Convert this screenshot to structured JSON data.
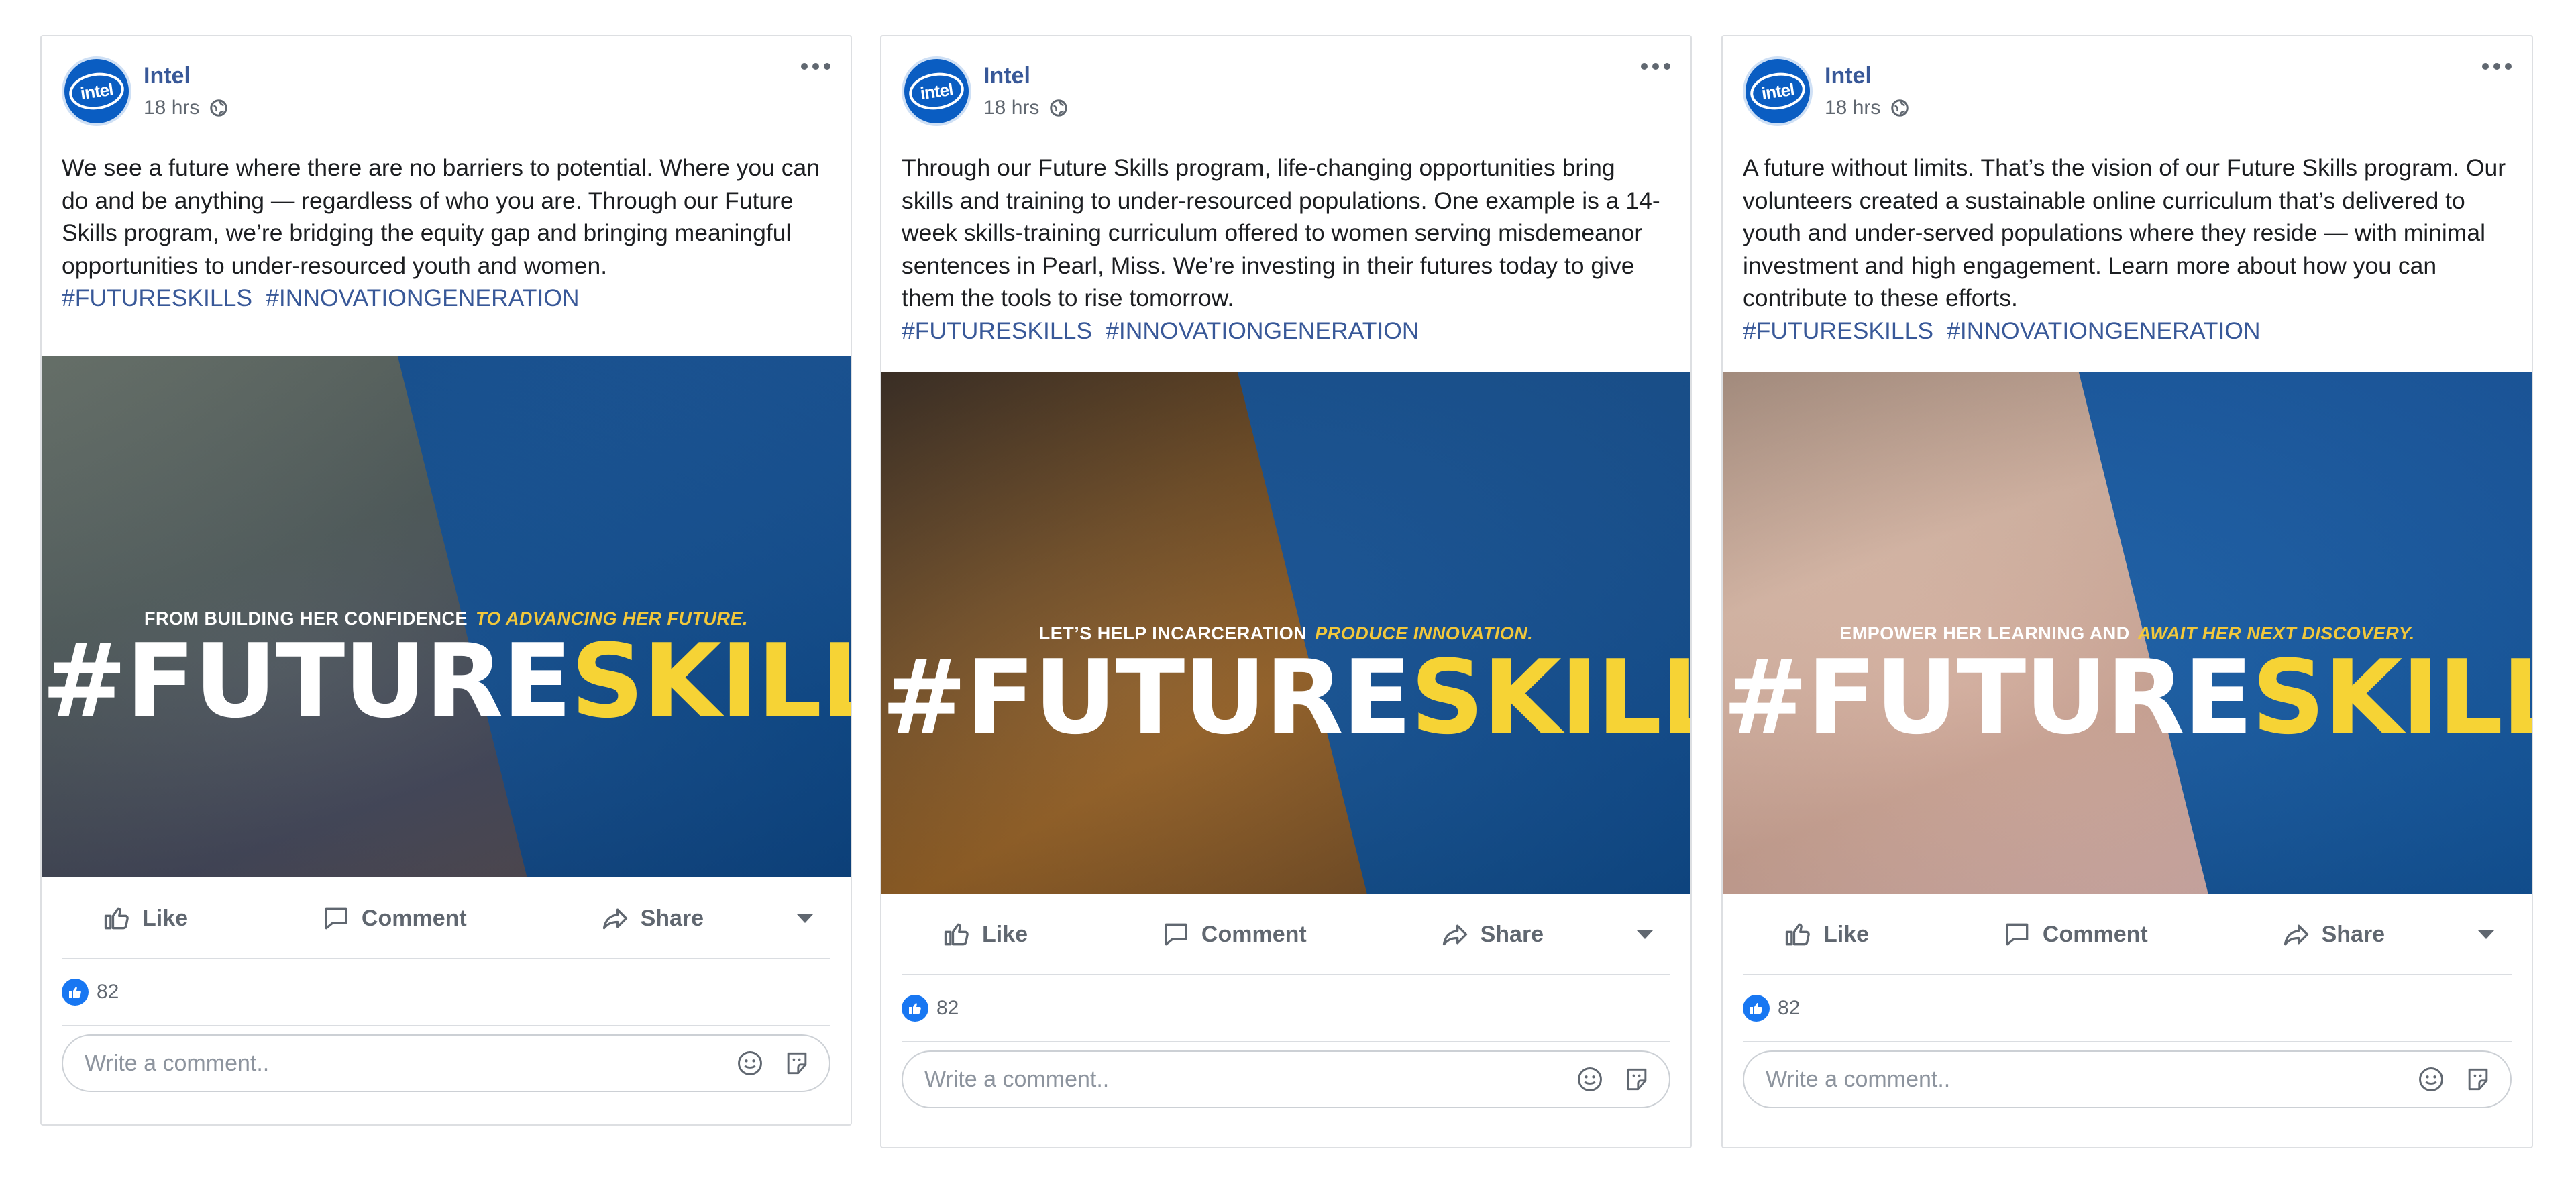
{
  "posts": [
    {
      "author": "Intel",
      "time": "18 hrs",
      "text": "We see a future where there are no barriers to potential. Where you can do and be anything — regardless of who you are. Through our Future Skills program, we’re bridging the equity gap and bringing meaningful opportunities to under-resourced youth and women.",
      "hashtags": [
        "#FUTURESKILLS",
        "#INNOVATIONGENERATION"
      ],
      "image": {
        "tagline_white": "FROM BUILDING HER CONFIDENCE",
        "tagline_yellow": "TO ADVANCING HER FUTURE.",
        "headline_white": "#FUTURE",
        "headline_yellow": "SKILLS"
      },
      "actions": {
        "like": "Like",
        "comment": "Comment",
        "share": "Share"
      },
      "reaction_count": "82",
      "comment_placeholder": "Write a comment.."
    },
    {
      "author": "Intel",
      "time": "18 hrs",
      "text": "Through our Future Skills program, life-changing opportunities bring skills and training to under-resourced populations. One example is a 14-week skills-training curriculum offered to women serving misdemeanor sentences in Pearl, Miss. We’re investing in their futures today to give them the tools to rise tomorrow.",
      "hashtags": [
        "#FUTURESKILLS",
        "#INNOVATIONGENERATION"
      ],
      "image": {
        "tagline_white": "LET’S HELP INCARCERATION",
        "tagline_yellow": "PRODUCE INNOVATION.",
        "headline_white": "#FUTURE",
        "headline_yellow": "SKILLS"
      },
      "actions": {
        "like": "Like",
        "comment": "Comment",
        "share": "Share"
      },
      "reaction_count": "82",
      "comment_placeholder": "Write a comment.."
    },
    {
      "author": "Intel",
      "time": "18 hrs",
      "text": "A future without limits. That’s the vision of our Future Skills program. Our volunteers created a sustainable online curriculum that’s delivered to youth and under-served populations where they reside — with minimal investment and high engagement. Learn more about how you can contribute to these efforts.",
      "hashtags": [
        "#FUTURESKILLS",
        "#INNOVATIONGENERATION"
      ],
      "image": {
        "tagline_white": "EMPOWER HER LEARNING AND",
        "tagline_yellow": "AWAIT HER NEXT DISCOVERY.",
        "headline_white": "#FUTURE",
        "headline_yellow": "SKILLS"
      },
      "actions": {
        "like": "Like",
        "comment": "Comment",
        "share": "Share"
      },
      "reaction_count": "82",
      "comment_placeholder": "Write a comment.."
    }
  ],
  "icons": {
    "avatar_logo": "intel",
    "audience": "globe-icon",
    "more": "more-options-icon",
    "like": "thumbs-up-icon",
    "comment": "comment-bubble-icon",
    "share": "share-arrow-icon",
    "emoji": "emoji-icon",
    "sticker": "sticker-icon"
  },
  "colors": {
    "link": "#385898",
    "accent_yellow": "#f6d335",
    "like_blue": "#1877f2"
  }
}
